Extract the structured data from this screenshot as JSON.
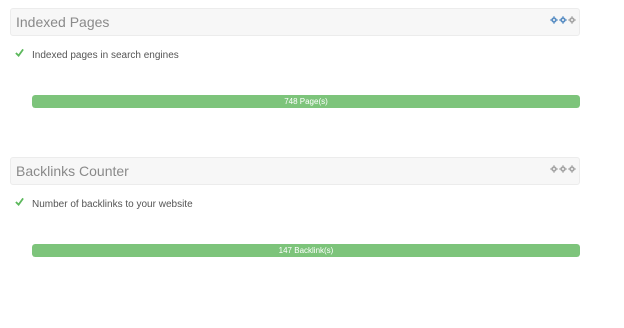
{
  "panels": [
    {
      "title": "Indexed Pages",
      "description": "Indexed pages in search engines",
      "progress_label": "748 Page(s)",
      "progress_fraction": 1.0,
      "header_icons": [
        "gear-icon",
        "gear-icon",
        "gear-icon"
      ],
      "header_icon_color": "#5b8fc4"
    },
    {
      "title": "Backlinks Counter",
      "description": "Number of backlinks to your website",
      "progress_label": "147 Backlink(s)",
      "progress_fraction": 1.0,
      "header_icons": [
        "gear-icon",
        "gear-icon",
        "gear-icon"
      ],
      "header_icon_color": "#a6a6a6"
    }
  ],
  "colors": {
    "progress_fill": "#7dc47b",
    "check": "#5cb85c"
  }
}
